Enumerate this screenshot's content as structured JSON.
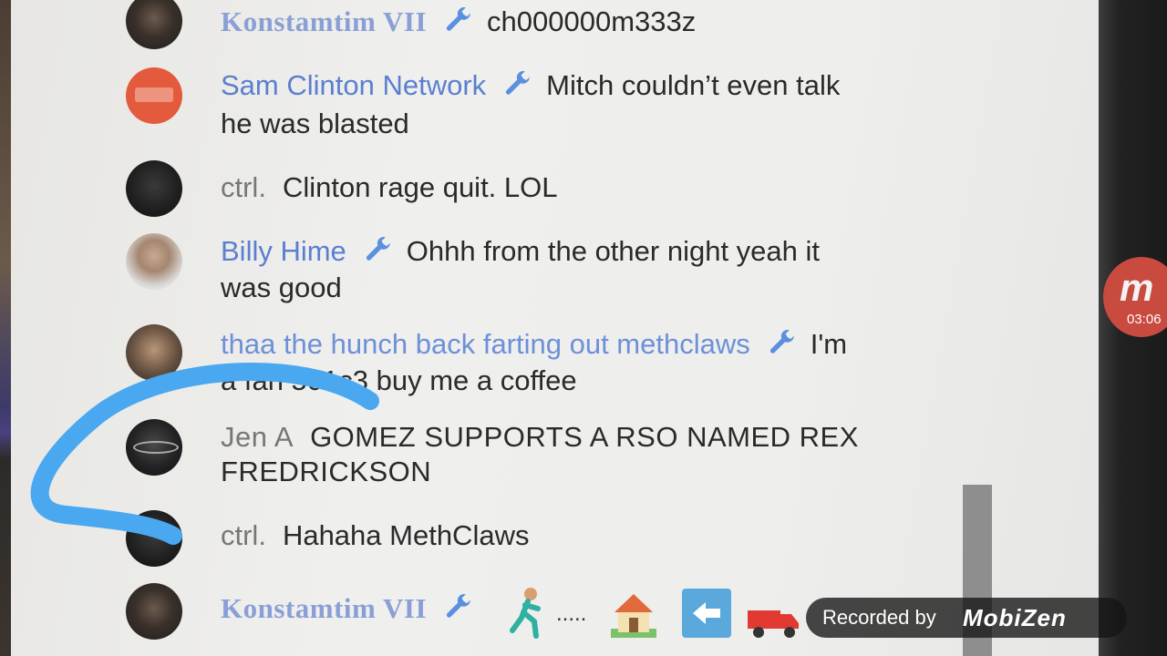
{
  "chat": {
    "messages": [
      {
        "author": "Konstamtim VII",
        "has_wrench": true,
        "text": "ch000000m333z"
      },
      {
        "author": "Sam Clinton Network",
        "has_wrench": true,
        "text": "Mitch couldn’t even talk",
        "text_line2": "he was blasted"
      },
      {
        "author": "ctrl.",
        "has_wrench": false,
        "text": "Clinton rage quit. LOL"
      },
      {
        "author": "Billy Hime",
        "has_wrench": true,
        "text": "Ohhh from the other night yeah it",
        "text_line2": "was good"
      },
      {
        "author": "thaa the hunch back farting out methclaws",
        "has_wrench": true,
        "text": "I'm",
        "text_line2": "a fan 501c3 buy me a coffee"
      },
      {
        "author": "Jen A",
        "has_wrench": false,
        "text": "GOMEZ SUPPORTS A RSO NAMED REX",
        "text_line2": "FREDRICKSON"
      },
      {
        "author": "ctrl.",
        "has_wrench": false,
        "text": "Hahaha MethClaws"
      },
      {
        "author": "Konstamtim VII",
        "has_wrench": true,
        "text": "....."
      }
    ],
    "last_message_emojis": [
      "person-running-icon",
      "house-icon",
      "left-arrow-icon",
      "red-truck-icon"
    ]
  },
  "recorder": {
    "timer": "03:06",
    "badge_letter": "m",
    "recorded_label": "Recorded by",
    "brand": "MobiZen"
  },
  "colors": {
    "author_blue": "#5b7fd0",
    "annotation_blue": "#4aa8f0",
    "badge_red": "#c94a3f"
  }
}
